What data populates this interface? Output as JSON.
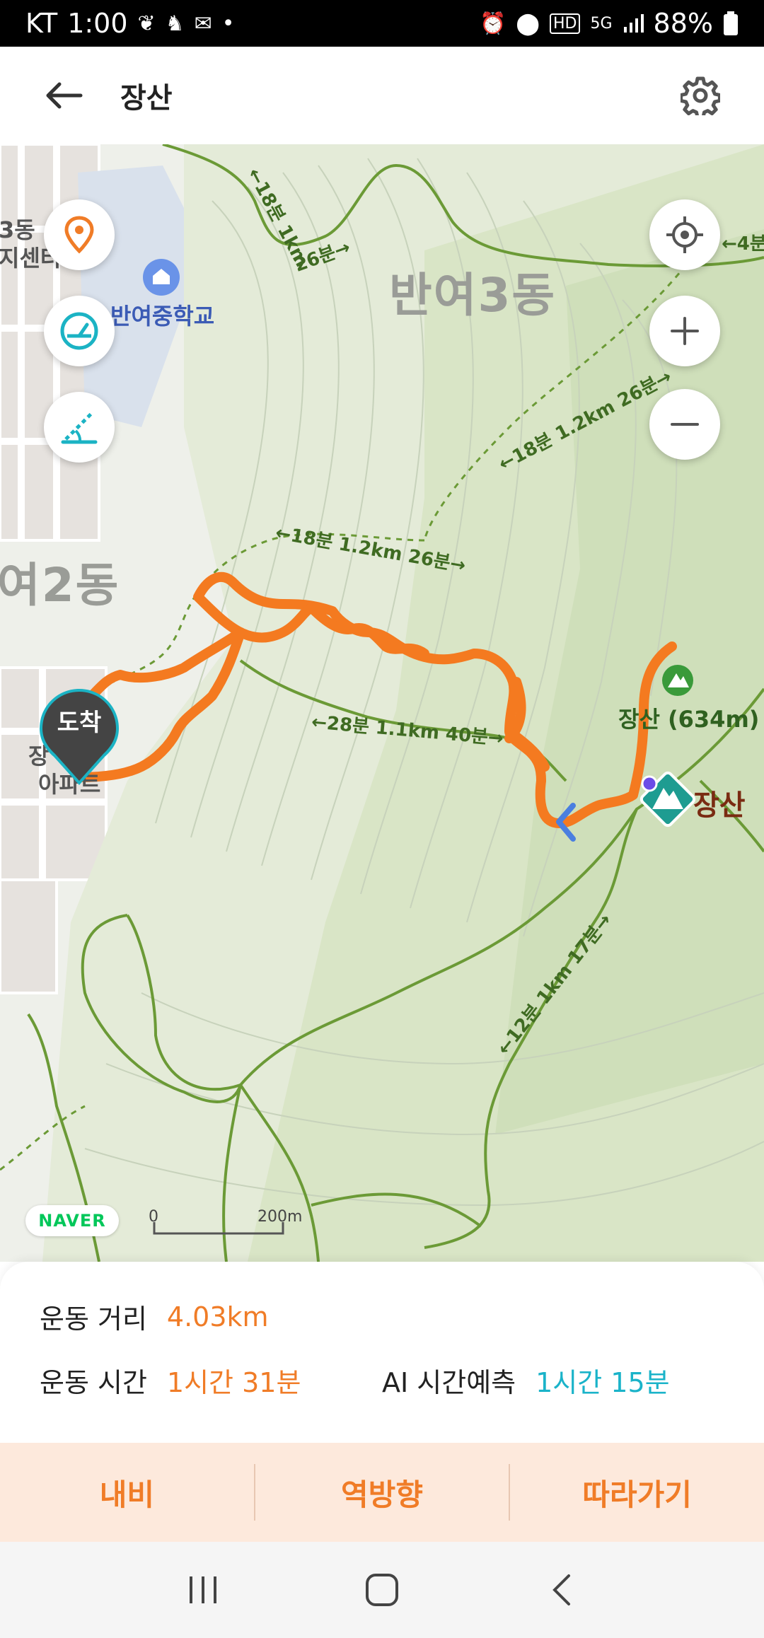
{
  "status_bar": {
    "carrier": "KT",
    "time": "1:00",
    "battery": "88%",
    "icons": [
      "leaf-icon",
      "runner-icon",
      "mail-icon",
      "dot-icon",
      "alarm-icon",
      "location-icon",
      "hd-icon",
      "5g-icon",
      "signal-icon",
      "battery-icon"
    ]
  },
  "header": {
    "title": "장산",
    "back_icon": "arrow-left-icon",
    "settings_icon": "gear-icon"
  },
  "map": {
    "area_labels": [
      "반여3동",
      "여2동"
    ],
    "poi_labels": [
      "반여중학교",
      "3동",
      "지센터"
    ],
    "partial_labels": [
      "장",
      "아파트"
    ],
    "trail_labels": [
      "←18분 1km",
      "26분→",
      "←4분",
      "←18분 1.2km 26분→",
      "←18분 1.2km 26분→",
      "←28분 1.1km 40분→",
      "←12분 1km 17분→"
    ],
    "peak_label": "장산 (634m)",
    "mountain_label": "장산",
    "arrive_label": "도착",
    "left_buttons": [
      "pin-icon",
      "speedometer-icon",
      "slope-icon"
    ],
    "right_buttons": [
      "locate-icon",
      "zoom-in-icon",
      "zoom-out-icon"
    ],
    "logo": "NAVER",
    "scale_zero": "0",
    "scale_end": "200m",
    "colors": {
      "route": "#f47a20",
      "trail": "#6b9a36",
      "land": "#eef0ea",
      "forest": "#dfe8cc"
    }
  },
  "stats": {
    "distance_label": "운동 거리",
    "distance_value": "4.03km",
    "time_label": "운동 시간",
    "time_value": "1시간 31분",
    "ai_label": "AI 시간예측",
    "ai_value": "1시간 15분"
  },
  "actions": {
    "navi": "내비",
    "reverse": "역방향",
    "follow": "따라가기"
  },
  "nav_bar": {
    "icons": [
      "recent-apps-icon",
      "home-icon",
      "back-icon"
    ]
  }
}
